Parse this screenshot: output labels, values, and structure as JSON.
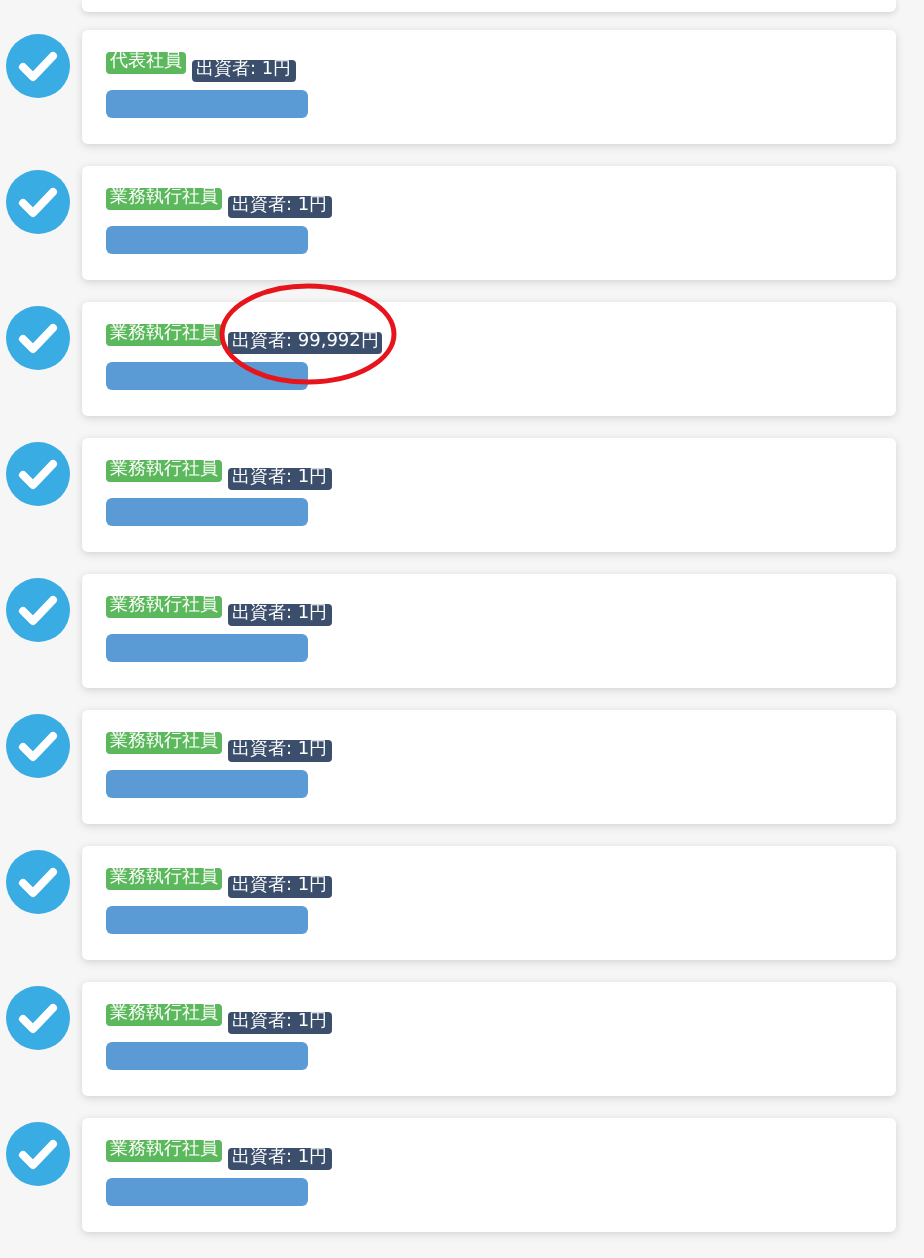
{
  "members": [
    {
      "checked": true,
      "role": "代表社員",
      "investment": "出資者: 1円",
      "circled": false
    },
    {
      "checked": true,
      "role": "業務執行社員",
      "investment": "出資者: 1円",
      "circled": false
    },
    {
      "checked": true,
      "role": "業務執行社員",
      "investment": "出資者: 99,992円",
      "circled": true
    },
    {
      "checked": true,
      "role": "業務執行社員",
      "investment": "出資者: 1円",
      "circled": false
    },
    {
      "checked": true,
      "role": "業務執行社員",
      "investment": "出資者: 1円",
      "circled": false
    },
    {
      "checked": true,
      "role": "業務執行社員",
      "investment": "出資者: 1円",
      "circled": false
    },
    {
      "checked": true,
      "role": "業務執行社員",
      "investment": "出資者: 1円",
      "circled": false
    },
    {
      "checked": true,
      "role": "業務執行社員",
      "investment": "出資者: 1円",
      "circled": false
    },
    {
      "checked": true,
      "role": "業務執行社員",
      "investment": "出資者: 1円",
      "circled": false
    }
  ]
}
